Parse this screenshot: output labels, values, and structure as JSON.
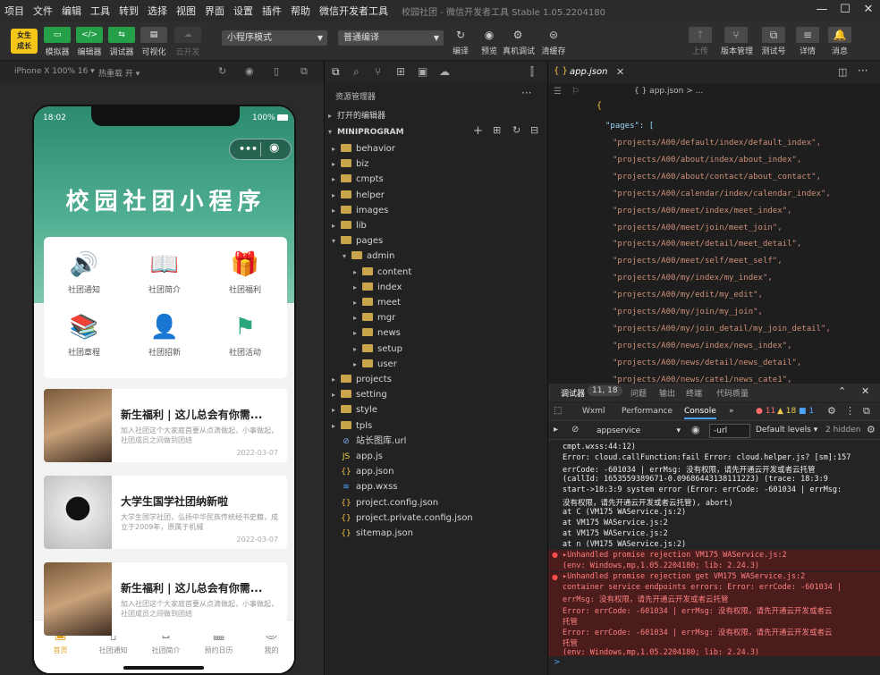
{
  "menu": [
    "项目",
    "文件",
    "编辑",
    "工具",
    "转到",
    "选择",
    "视图",
    "界面",
    "设置",
    "插件",
    "帮助",
    "微信开发者工具"
  ],
  "window_title": "校园社团 - 微信开发者工具 Stable 1.05.2204180",
  "toolbar": {
    "avatar_text": "女生\n成长",
    "modes": [
      {
        "label": "模拟器",
        "icon": "▭"
      },
      {
        "label": "编辑器",
        "icon": "</>"
      },
      {
        "label": "调试器",
        "icon": "⇆"
      },
      {
        "label": "可视化",
        "icon": "▤"
      },
      {
        "label": "云开发",
        "icon": "☁"
      }
    ],
    "mode_select": "小程序模式",
    "compile_select": "普通编译",
    "actions": [
      {
        "label": "编译",
        "icon": "↻"
      },
      {
        "label": "预览",
        "icon": "◉"
      },
      {
        "label": "真机调试",
        "icon": "⚙"
      },
      {
        "label": "清缓存",
        "icon": "⊜"
      }
    ],
    "right_actions": [
      {
        "label": "上传",
        "icon": "↑"
      },
      {
        "label": "版本管理",
        "icon": "⑂"
      },
      {
        "label": "测试号",
        "icon": "⧉"
      },
      {
        "label": "详情",
        "icon": "≡"
      },
      {
        "label": "消息",
        "icon": "🔔"
      }
    ]
  },
  "subbar": {
    "device": "iPhone X 100% 16 ▾",
    "hotreload": "热重载 开 ▾"
  },
  "phone": {
    "time": "18:02",
    "battery": "100%",
    "title": "校园社团小程序",
    "grid": [
      {
        "label": "社团通知",
        "icon": "🔊",
        "color": "#f0a030"
      },
      {
        "label": "社团简介",
        "icon": "📖",
        "color": "#f0a030"
      },
      {
        "label": "社团福利",
        "icon": "🎁",
        "color": "#2aa67c"
      },
      {
        "label": "社团章程",
        "icon": "📚",
        "color": "#2aa67c"
      },
      {
        "label": "社团招新",
        "icon": "👤",
        "color": "#2aa67c"
      },
      {
        "label": "社团活动",
        "icon": "⚑",
        "color": "#2aa67c"
      }
    ],
    "news": [
      {
        "title": "新生福利 | 这儿总会有你需...",
        "desc": "加入社团这个大家庭首要从点滴做起，小事做起，社团成员之间做到团结",
        "date": "2022-03-07"
      },
      {
        "title": "大学生国学社团纳新啦",
        "desc": "大学生国学社团，弘扬中华民族传统经书史籍，成立于2009年，原属于机械",
        "date": "2022-03-07"
      },
      {
        "title": "新生福利 | 这儿总会有你需...",
        "desc": "加入社团这个大家庭首要从点滴做起，小事做起，社团成员之间做到团结",
        "date": ""
      }
    ],
    "tabs": [
      {
        "label": "首页",
        "icon": "▣"
      },
      {
        "label": "社团通知",
        "icon": "▯"
      },
      {
        "label": "社团简介",
        "icon": "⌂"
      },
      {
        "label": "预约日历",
        "icon": "▦"
      },
      {
        "label": "我的",
        "icon": "☺"
      }
    ]
  },
  "explorer": {
    "title": "资源管理器",
    "open_editors": "打开的编辑器",
    "root": "MINIPROGRAM",
    "items": [
      {
        "name": "behavior",
        "depth": 1,
        "type": "folder"
      },
      {
        "name": "biz",
        "depth": 1,
        "type": "folder"
      },
      {
        "name": "cmpts",
        "depth": 1,
        "type": "folder"
      },
      {
        "name": "helper",
        "depth": 1,
        "type": "folder"
      },
      {
        "name": "images",
        "depth": 1,
        "type": "folder"
      },
      {
        "name": "lib",
        "depth": 1,
        "type": "folder"
      },
      {
        "name": "pages",
        "depth": 1,
        "type": "folder-open"
      },
      {
        "name": "admin",
        "depth": 2,
        "type": "folder-open"
      },
      {
        "name": "content",
        "depth": 3,
        "type": "folder"
      },
      {
        "name": "index",
        "depth": 3,
        "type": "folder"
      },
      {
        "name": "meet",
        "depth": 3,
        "type": "folder"
      },
      {
        "name": "mgr",
        "depth": 3,
        "type": "folder"
      },
      {
        "name": "news",
        "depth": 3,
        "type": "folder"
      },
      {
        "name": "setup",
        "depth": 3,
        "type": "folder"
      },
      {
        "name": "user",
        "depth": 3,
        "type": "folder"
      },
      {
        "name": "projects",
        "depth": 1,
        "type": "folder"
      },
      {
        "name": "setting",
        "depth": 1,
        "type": "folder"
      },
      {
        "name": "style",
        "depth": 1,
        "type": "folder"
      },
      {
        "name": "tpls",
        "depth": 1,
        "type": "folder"
      },
      {
        "name": "站长图库.url",
        "depth": 1,
        "type": "link"
      },
      {
        "name": "app.js",
        "depth": 1,
        "type": "js"
      },
      {
        "name": "app.json",
        "depth": 1,
        "type": "json"
      },
      {
        "name": "app.wxss",
        "depth": 1,
        "type": "wxss"
      },
      {
        "name": "project.config.json",
        "depth": 1,
        "type": "json"
      },
      {
        "name": "project.private.config.json",
        "depth": 1,
        "type": "json"
      },
      {
        "name": "sitemap.json",
        "depth": 1,
        "type": "json"
      }
    ]
  },
  "editor": {
    "tab": "app.json",
    "breadcrumb": "{ } app.json > ...",
    "pages_key": "\"pages\": [",
    "lines": [
      "\"projects/A00/default/index/default_index\",",
      "\"projects/A00/about/index/about_index\",",
      "\"projects/A00/about/contact/about_contact\",",
      "\"projects/A00/calendar/index/calendar_index\",",
      "\"projects/A00/meet/index/meet_index\",",
      "\"projects/A00/meet/join/meet_join\",",
      "\"projects/A00/meet/detail/meet_detail\",",
      "\"projects/A00/meet/self/meet_self\",",
      "\"projects/A00/my/index/my_index\",",
      "\"projects/A00/my/edit/my_edit\",",
      "\"projects/A00/my/join/my_join\",",
      "\"projects/A00/my/join_detail/my_join_detail\",",
      "\"projects/A00/news/index/news_index\",",
      "\"projects/A00/news/detail/news_detail\",",
      "\"projects/A00/news/cate1/news_cate1\","
    ]
  },
  "console": {
    "panel_label": "调试器",
    "badge": "11, 18",
    "panel_tabs": [
      "问题",
      "输出",
      "终端",
      "代码质量"
    ],
    "devtabs": [
      "Wxml",
      "Performance",
      "Console",
      "»"
    ],
    "errors_count": "11",
    "warn_count": "18",
    "info_count": "1",
    "context": "appservice",
    "filter": "-url",
    "levels": "Default levels ▾",
    "hidden": "2 hidden",
    "lines": [
      {
        "text": "cmpt.wxss:44:12)",
        "cls": ""
      },
      {
        "text": "Error: cloud.callFunction:fail Error: cloud.helper.js? [sm]:157",
        "cls": ""
      },
      {
        "text": "errCode: -601034  | errMsg: 没有权限，请先开通云开发或者云托管",
        "cls": ""
      },
      {
        "text": "(callId: 1653559389671-0.09686443138111223) (trace: 18:3:9",
        "cls": ""
      },
      {
        "text": "start->18:3:9 system error (Error: errCode: -601034  | errMsg:",
        "cls": ""
      },
      {
        "text": "没有权限，请先开通云开发或者云托管), abort)",
        "cls": ""
      },
      {
        "text": "    at C (VM175 WAService.js:2)",
        "cls": ""
      },
      {
        "text": "    at VM175 WAService.js:2",
        "cls": ""
      },
      {
        "text": "    at VM175 WAService.js:2",
        "cls": ""
      },
      {
        "text": "    at n (VM175 WAService.js:2)",
        "cls": ""
      },
      {
        "text": "▸Unhandled promise rejection              VM175 WAService.js:2",
        "cls": "red"
      },
      {
        "text": "(env: Windows,mp,1.05.2204180; lib: 2.24.3)",
        "cls": "red"
      },
      {
        "text": "▸Unhandled promise rejection get          VM175 WAService.js:2",
        "cls": "red"
      },
      {
        "text": "container service endpoints errors: Error: errCode: -601034  |",
        "cls": "red"
      },
      {
        "text": "errMsg: 没有权限，请先开通云开发或者云托管",
        "cls": "red"
      },
      {
        "text": "Error: errCode: -601034  | errMsg: 没有权限，请先开通云开发或者云",
        "cls": "red"
      },
      {
        "text": "托管",
        "cls": "red"
      },
      {
        "text": "Error: errCode: -601034  | errMsg: 没有权限，请先开通云开发或者云",
        "cls": "red"
      },
      {
        "text": "托管",
        "cls": "red"
      },
      {
        "text": "(env: Windows,mp,1.05.2204180; lib: 2.24.3)",
        "cls": "red"
      }
    ],
    "prompt": ">"
  }
}
